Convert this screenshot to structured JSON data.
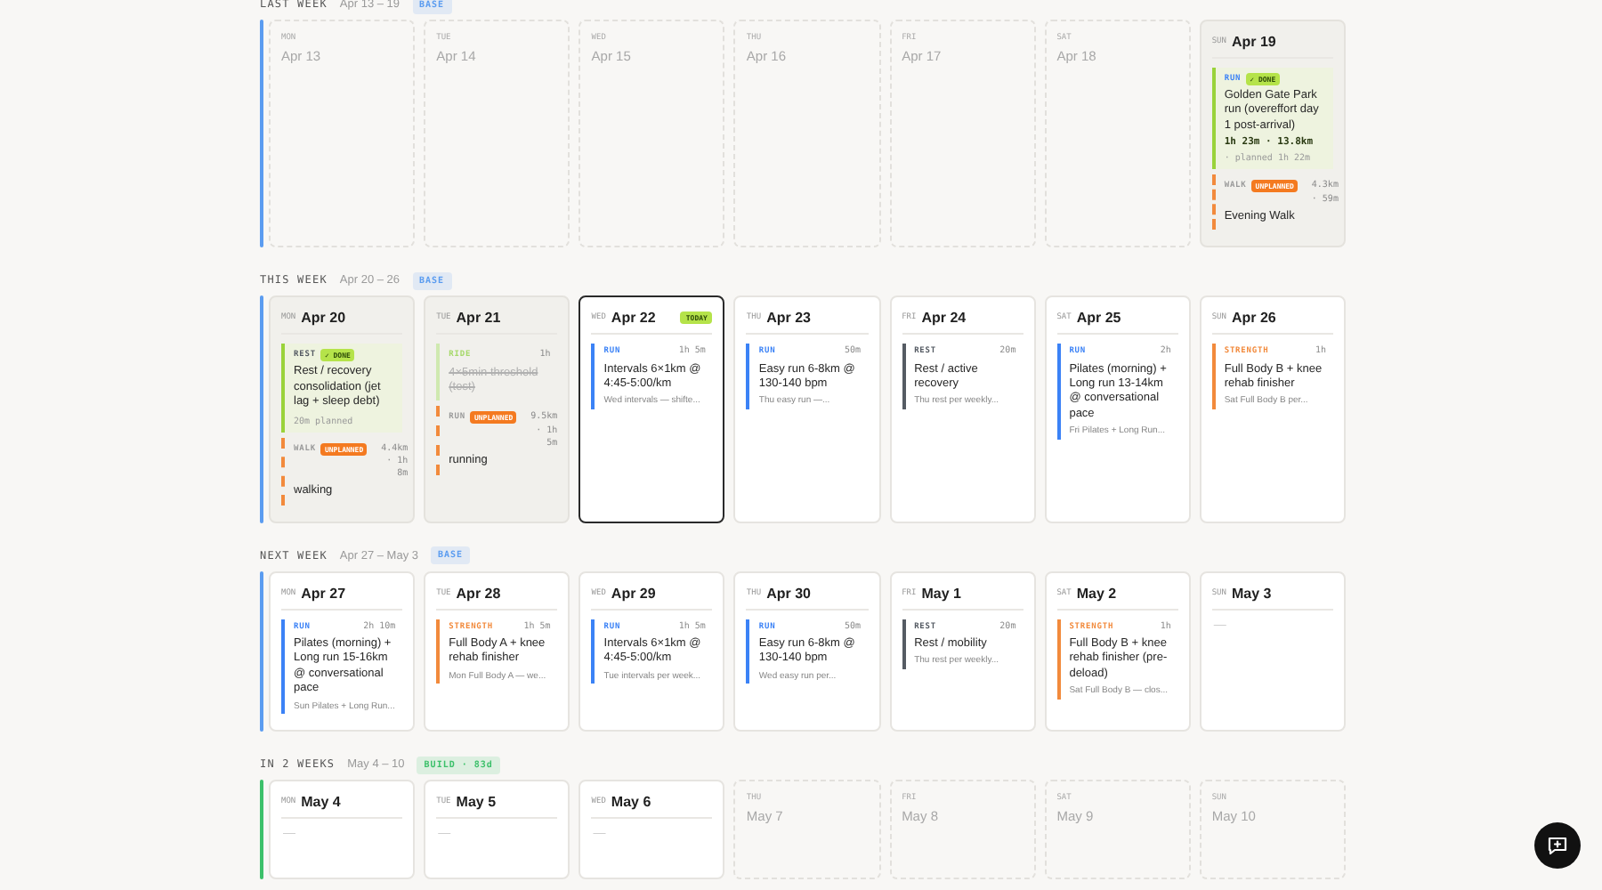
{
  "weeks": [
    {
      "label": "LAST WEEK",
      "range": "Apr 13 – 19",
      "phase": "BASE",
      "color": "#5b9cf0",
      "days": [
        {
          "kind": "blank",
          "dow": "MON",
          "date": "Apr 13"
        },
        {
          "kind": "blank",
          "dow": "TUE",
          "date": "Apr 14"
        },
        {
          "kind": "blank",
          "dow": "WED",
          "date": "Apr 15"
        },
        {
          "kind": "blank",
          "dow": "THU",
          "date": "Apr 16"
        },
        {
          "kind": "blank",
          "dow": "FRI",
          "date": "Apr 17"
        },
        {
          "kind": "blank",
          "dow": "SAT",
          "date": "Apr 18"
        },
        {
          "kind": "past",
          "dow": "SUN",
          "date": "Apr 19",
          "workouts": [
            {
              "kind": "done",
              "type": "RUN",
              "color": "#3b82f6",
              "badge": "✓ DONE",
              "title": "Golden Gate Park run (overeffort day 1 post-arrival)",
              "stats": "1h 23m · 13.8km",
              "planned": "· planned 1h 22m"
            },
            {
              "kind": "unplanned",
              "type": "WALK",
              "color": "#9a9a9a",
              "badge": "UNPLANNED",
              "duration": "4.3km · 59m",
              "title": "Evening Walk"
            }
          ]
        }
      ]
    },
    {
      "label": "THIS WEEK",
      "range": "Apr 20 – 26",
      "phase": "BASE",
      "color": "#5b9cf0",
      "days": [
        {
          "kind": "past",
          "dow": "MON",
          "date": "Apr 20",
          "workouts": [
            {
              "kind": "done",
              "type": "REST",
              "color": "#555b63",
              "badge": "✓ DONE",
              "title": "Rest / recovery consolidation (jet lag + sleep debt)",
              "planned": "20m planned"
            },
            {
              "kind": "unplanned",
              "type": "WALK",
              "color": "#9a9a9a",
              "badge": "UNPLANNED",
              "duration": "4.4km · 1h 8m",
              "title": "walking"
            }
          ]
        },
        {
          "kind": "past",
          "dow": "TUE",
          "date": "Apr 21",
          "workouts": [
            {
              "kind": "skipped",
              "type": "RIDE",
              "color": "#a6d96a",
              "duration": "1h",
              "title": "4×5min threshold (test)"
            },
            {
              "kind": "unplanned",
              "type": "RUN",
              "color": "#9a9a9a",
              "badge": "UNPLANNED",
              "duration": "9.5km · 1h 5m",
              "title": "running"
            }
          ]
        },
        {
          "kind": "plan",
          "today": true,
          "today_label": "TODAY",
          "dow": "WED",
          "date": "Apr 22",
          "workouts": [
            {
              "kind": "planned",
              "type": "RUN",
              "color": "#3b82f6",
              "duration": "1h 5m",
              "title": "Intervals 6×1km @ 4:45-5:00/km",
              "note": "Wed intervals — shifte..."
            }
          ]
        },
        {
          "kind": "plan",
          "today": false,
          "dow": "THU",
          "date": "Apr 23",
          "workouts": [
            {
              "kind": "planned",
              "type": "RUN",
              "color": "#3b82f6",
              "duration": "50m",
              "title": "Easy run 6-8km @ 130-140 bpm",
              "note": "Thu easy run —..."
            }
          ]
        },
        {
          "kind": "plan",
          "today": false,
          "dow": "FRI",
          "date": "Apr 24",
          "workouts": [
            {
              "kind": "planned",
              "type": "REST",
              "color": "#555b63",
              "duration": "20m",
              "title": "Rest / active recovery",
              "note": "Thu rest per weekly..."
            }
          ]
        },
        {
          "kind": "plan",
          "today": false,
          "dow": "SAT",
          "date": "Apr 25",
          "workouts": [
            {
              "kind": "planned",
              "type": "RUN",
              "color": "#3b82f6",
              "duration": "2h",
              "title": "Pilates (morning) + Long run 13-14km @ conversational pace",
              "note": "Fri Pilates + Long Run..."
            }
          ]
        },
        {
          "kind": "plan",
          "today": false,
          "dow": "SUN",
          "date": "Apr 26",
          "workouts": [
            {
              "kind": "planned",
              "type": "STRENGTH",
              "color": "#f28a3c",
              "duration": "1h",
              "title": "Full Body B + knee rehab finisher",
              "note": "Sat Full Body B per..."
            }
          ]
        }
      ]
    },
    {
      "label": "NEXT WEEK",
      "range": "Apr 27 – May 3",
      "phase": "BASE",
      "color": "#5b9cf0",
      "days": [
        {
          "kind": "plan",
          "today": false,
          "dow": "MON",
          "date": "Apr 27",
          "workouts": [
            {
              "kind": "planned",
              "type": "RUN",
              "color": "#3b82f6",
              "duration": "2h 10m",
              "title": "Pilates (morning) + Long run 15-16km @ conversational pace",
              "note": "Sun Pilates + Long Run..."
            }
          ]
        },
        {
          "kind": "plan",
          "today": false,
          "dow": "TUE",
          "date": "Apr 28",
          "workouts": [
            {
              "kind": "planned",
              "type": "STRENGTH",
              "color": "#f28a3c",
              "duration": "1h 5m",
              "title": "Full Body A + knee rehab finisher",
              "note": "Mon Full Body A — we..."
            }
          ]
        },
        {
          "kind": "plan",
          "today": false,
          "dow": "WED",
          "date": "Apr 29",
          "workouts": [
            {
              "kind": "planned",
              "type": "RUN",
              "color": "#3b82f6",
              "duration": "1h 5m",
              "title": "Intervals 6×1km @ 4:45-5:00/km",
              "note": "Tue intervals per week..."
            }
          ]
        },
        {
          "kind": "plan",
          "today": false,
          "dow": "THU",
          "date": "Apr 30",
          "workouts": [
            {
              "kind": "planned",
              "type": "RUN",
              "color": "#3b82f6",
              "duration": "50m",
              "title": "Easy run 6-8km @ 130-140 bpm",
              "note": "Wed easy run per..."
            }
          ]
        },
        {
          "kind": "plan",
          "today": false,
          "dow": "FRI",
          "date": "May 1",
          "workouts": [
            {
              "kind": "planned",
              "type": "REST",
              "color": "#555b63",
              "duration": "20m",
              "title": "Rest / mobility",
              "note": "Thu rest per weekly..."
            }
          ]
        },
        {
          "kind": "plan",
          "today": false,
          "dow": "SAT",
          "date": "May 2",
          "workouts": [
            {
              "kind": "planned",
              "type": "STRENGTH",
              "color": "#f28a3c",
              "duration": "1h",
              "title": "Full Body B + knee rehab finisher (pre-deload)",
              "note": "Sat Full Body B — clos..."
            }
          ]
        },
        {
          "kind": "plan",
          "today": false,
          "dow": "SUN",
          "date": "May 3",
          "empty": "—"
        }
      ]
    },
    {
      "label": "IN 2 WEEKS",
      "range": "May 4 – 10",
      "phase": "BUILD · 83d",
      "color": "#3cc06a",
      "days": [
        {
          "kind": "plan",
          "today": false,
          "dow": "MON",
          "date": "May 4",
          "empty": "—"
        },
        {
          "kind": "plan",
          "today": false,
          "dow": "TUE",
          "date": "May 5",
          "empty": "—"
        },
        {
          "kind": "plan",
          "today": false,
          "dow": "WED",
          "date": "May 6",
          "empty": "—"
        },
        {
          "kind": "blank",
          "dow": "THU",
          "date": "May 7"
        },
        {
          "kind": "blank",
          "dow": "FRI",
          "date": "May 8"
        },
        {
          "kind": "blank",
          "dow": "SAT",
          "date": "May 9"
        },
        {
          "kind": "blank",
          "dow": "SUN",
          "date": "May 10"
        }
      ]
    }
  ]
}
